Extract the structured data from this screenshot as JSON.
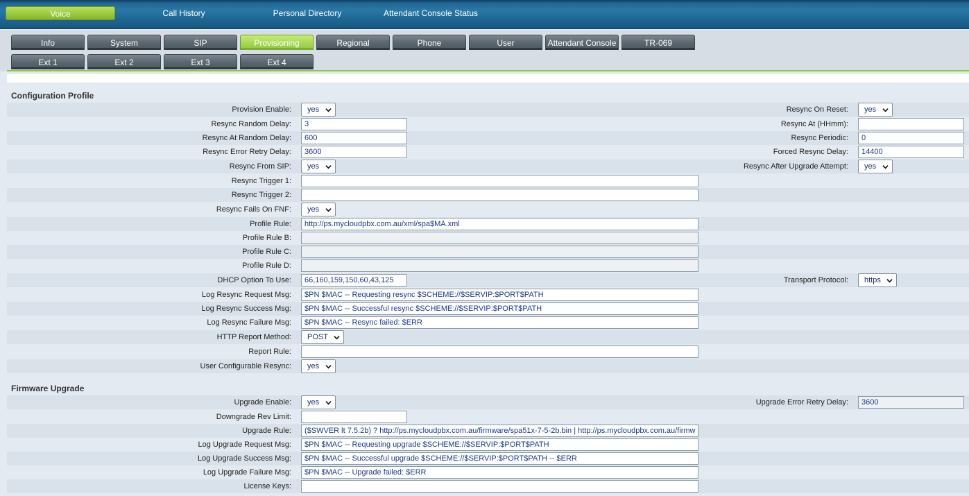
{
  "top_nav": [
    "Voice",
    "Call History",
    "Personal Directory",
    "Attendant Console Status"
  ],
  "tabs_row1": [
    "Info",
    "System",
    "SIP",
    "Provisioning",
    "Regional",
    "Phone",
    "User",
    "Attendant Console",
    "TR-069"
  ],
  "tabs_row2": [
    "Ext 1",
    "Ext 2",
    "Ext 3",
    "Ext 4"
  ],
  "active_tab": "Provisioning",
  "config_profile": {
    "title": "Configuration Profile",
    "provision_enable": {
      "label": "Provision Enable:",
      "value": "yes"
    },
    "resync_on_reset": {
      "label": "Resync On Reset:",
      "value": "yes"
    },
    "resync_random_delay": {
      "label": "Resync Random Delay:",
      "value": "3"
    },
    "resync_at": {
      "label": "Resync At (HHmm):",
      "value": ""
    },
    "resync_at_random_delay": {
      "label": "Resync At Random Delay:",
      "value": "600"
    },
    "resync_periodic": {
      "label": "Resync Periodic:",
      "value": "0"
    },
    "resync_error_retry_delay": {
      "label": "Resync Error Retry Delay:",
      "value": "3600"
    },
    "forced_resync_delay": {
      "label": "Forced Resync Delay:",
      "value": "14400"
    },
    "resync_from_sip": {
      "label": "Resync From SIP:",
      "value": "yes"
    },
    "resync_after_upgrade": {
      "label": "Resync After Upgrade Attempt:",
      "value": "yes"
    },
    "resync_trigger_1": {
      "label": "Resync Trigger 1:",
      "value": ""
    },
    "resync_trigger_2": {
      "label": "Resync Trigger 2:",
      "value": ""
    },
    "resync_fails_on_fnf": {
      "label": "Resync Fails On FNF:",
      "value": "yes"
    },
    "profile_rule": {
      "label": "Profile Rule:",
      "value": "http://ps.mycloudpbx.com.au/xml/spa$MA.xml"
    },
    "profile_rule_b": {
      "label": "Profile Rule B:",
      "value": ""
    },
    "profile_rule_c": {
      "label": "Profile Rule C:",
      "value": ""
    },
    "profile_rule_d": {
      "label": "Profile Rule D:",
      "value": ""
    },
    "dhcp_option": {
      "label": "DHCP Option To Use:",
      "value": "66,160,159,150,60,43,125"
    },
    "transport_protocol": {
      "label": "Transport Protocol:",
      "value": "https"
    },
    "log_resync_request": {
      "label": "Log Resync Request Msg:",
      "value": "$PN $MAC -- Requesting resync $SCHEME://$SERVIP:$PORT$PATH"
    },
    "log_resync_success": {
      "label": "Log Resync Success Msg:",
      "value": "$PN $MAC -- Successful resync $SCHEME://$SERVIP:$PORT$PATH"
    },
    "log_resync_failure": {
      "label": "Log Resync Failure Msg:",
      "value": "$PN $MAC -- Resync failed: $ERR"
    },
    "http_report_method": {
      "label": "HTTP Report Method:",
      "value": "POST"
    },
    "report_rule": {
      "label": "Report Rule:",
      "value": ""
    },
    "user_configurable_resync": {
      "label": "User Configurable Resync:",
      "value": "yes"
    }
  },
  "firmware_upgrade": {
    "title": "Firmware Upgrade",
    "upgrade_enable": {
      "label": "Upgrade Enable:",
      "value": "yes"
    },
    "upgrade_error_retry_delay": {
      "label": "Upgrade Error Retry Delay:",
      "value": "3600"
    },
    "downgrade_rev_limit": {
      "label": "Downgrade Rev Limit:",
      "value": ""
    },
    "upgrade_rule": {
      "label": "Upgrade Rule:",
      "value": "($SWVER lt 7.5.2b) ? http://ps.mycloudpbx.com.au/firmware/spa51x-7-5-2b.bin | http://ps.mycloudpbx.com.au/firmw"
    },
    "log_upgrade_request": {
      "label": "Log Upgrade Request Msg:",
      "value": "$PN $MAC -- Requesting upgrade $SCHEME://$SERVIP:$PORT$PATH"
    },
    "log_upgrade_success": {
      "label": "Log Upgrade Success Msg:",
      "value": "$PN $MAC -- Successful upgrade $SCHEME://$SERVIP:$PORT$PATH -- $ERR"
    },
    "log_upgrade_failure": {
      "label": "Log Upgrade Failure Msg:",
      "value": "$PN $MAC -- Upgrade failed: $ERR"
    },
    "license_keys": {
      "label": "License Keys:",
      "value": ""
    }
  },
  "icons": {
    "dropdown": "chevron-down-icon"
  }
}
